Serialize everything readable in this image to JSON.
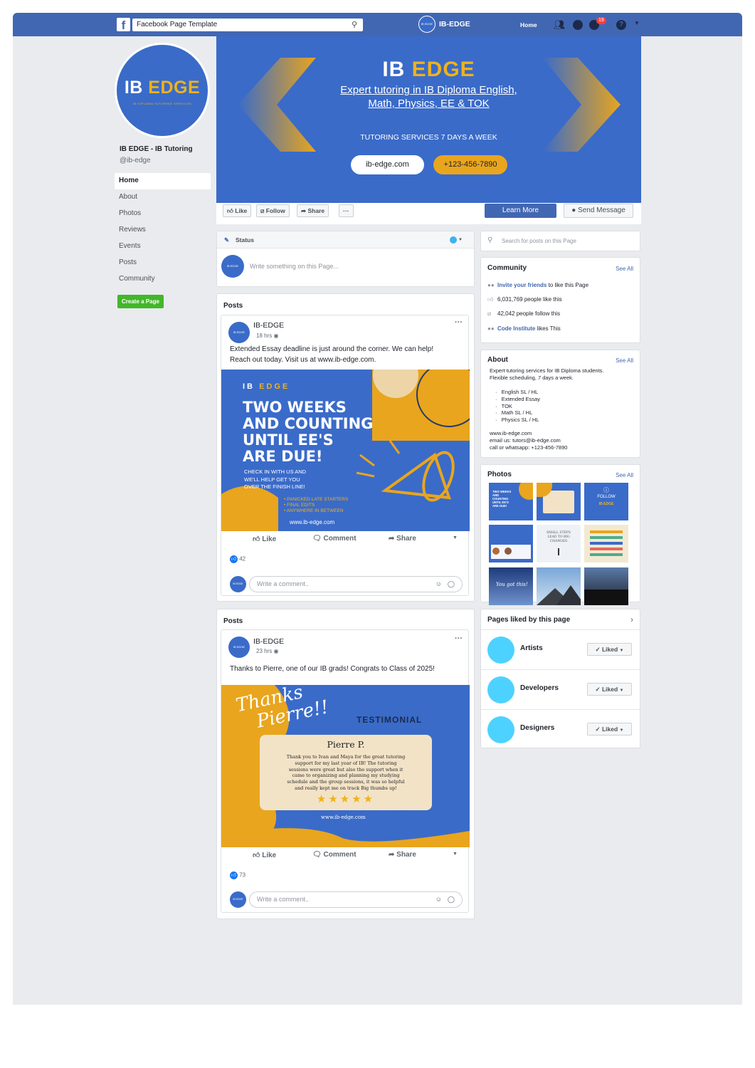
{
  "topbar": {
    "search_value": "Facebook Page Template",
    "brand_badge": "IB EDGE",
    "brand_name": "IB-EDGE",
    "home_label": "Home",
    "notification_count": "19",
    "colors": {
      "bar": "#4267b2"
    }
  },
  "profile": {
    "avatar_word_1": "IB",
    "avatar_word_2": "EDGE",
    "avatar_subtitle": "IB DIPLOMA TUTORING SERVICES",
    "page_name": "IB EDGE - IB Tutoring",
    "handle": "@ib-edge"
  },
  "nav": {
    "items": [
      "Home",
      "About",
      "Photos",
      "Reviews",
      "Events",
      "Posts",
      "Community"
    ],
    "create_page": "Create a Page"
  },
  "cover": {
    "title_1": "IB",
    "title_2": "EDGE",
    "subtitle_line1": "Expert tutoring in IB Diploma English,",
    "subtitle_line2": "Math, Physics, EE & TOK",
    "tagline": "TUTORING SERVICES 7 DAYS A WEEK",
    "website_button": "ib-edge.com",
    "phone_button": "+123-456-7890",
    "colors": {
      "blue": "#3a6bc9",
      "gold": "#e9a51d"
    }
  },
  "actions": {
    "like": "Like",
    "follow": "Follow",
    "share": "Share",
    "more": "···",
    "learn_more": "Learn More",
    "send_message": "Send Message"
  },
  "composer": {
    "status_label": "Status",
    "placeholder": "Write something on this Page..."
  },
  "posts": [
    {
      "section": "Posts",
      "author": "IB-EDGE",
      "time": "18 hrs",
      "text_line1": "Extended Essay deadline is just around the corner. We can help!",
      "text_line2": "Reach out today.  Visit us at www.ib-edge.com.",
      "image": {
        "brand_1": "IB",
        "brand_2": "EDGE",
        "headline": [
          "TWO WEEKS",
          "AND COUNTING",
          "UNTIL EE'S",
          "ARE DUE!"
        ],
        "body": [
          "CHECK IN WITH US AND",
          "WE'LL HELP GET YOU",
          "OVER THE FINISH LINE!"
        ],
        "bullets": [
          "PANICKED LATE STARTERS",
          "FINAL EDITS",
          "ANYWHERE IN BETWEEN"
        ],
        "url": "www.ib-edge.com"
      },
      "like": "Like",
      "comment": "Comment",
      "share": "Share",
      "reactions": "42",
      "comment_placeholder": "Write a comment.."
    },
    {
      "section": "Posts",
      "author": "IB-EDGE",
      "time": "23 hrs",
      "text_line1": "Thanks to Pierre, one of our IB grads!  Congrats to Class of 2025!",
      "image": {
        "script_line1": "Thanks",
        "script_line2": "Pierre!!",
        "label": "TESTIMONIAL",
        "name": "Pierre P.",
        "quote": [
          "Thank you to Ivan and Maya for the great tutoring",
          "support for my last year of IB!  The tutoring",
          "sessions were great but also the support when it",
          "came to organizing and planning my studying",
          "schedule and the group sessions, it was so helpful",
          "and really kept me on track  Big thumbs up!"
        ],
        "rating_stars": 5,
        "url": "www.ib-edge.com"
      },
      "like": "Like",
      "comment": "Comment",
      "share": "Share",
      "reactions": "73",
      "comment_placeholder": "Write a comment.."
    }
  ],
  "right": {
    "search_placeholder": "Search for posts on this Page",
    "community": {
      "title": "Community",
      "see_all": "See All",
      "invite_link": "Invite your friends",
      "invite_rest": " to like this Page",
      "likes": "6,031,769 people like this",
      "follows": "42,042 people follow this",
      "liker_link": "Code Institute",
      "liker_rest": " likes This"
    },
    "about": {
      "title": "About",
      "see_all": "See All",
      "lines": [
        "Expert tutoring services for IB Diploma students.",
        "Flexible scheduling, 7 days a week."
      ],
      "subjects": [
        "English SL / HL",
        "Extended Essay",
        "TOK",
        "Math SL / HL",
        "Physics SL / HL"
      ],
      "contact": [
        "www.ib-edge.com",
        "email us:  tutors@ib-edge.com",
        "call or whatsapp: +123-456-7890"
      ]
    },
    "photos": {
      "title": "Photos",
      "see_all": "See All",
      "thumb_1": "TWO WEEKS AND COUNTING UNTIL EE'S ARE DUE!",
      "thumb_3": "FOLLOW",
      "thumb_5": "SMALL STEPS LEAD TO BIG CHANGES",
      "thumb_7": "You got this!"
    },
    "pages_liked": {
      "title": "Pages liked by this page",
      "pages": [
        "Artists",
        "Developers",
        "Designers"
      ],
      "liked_label": "Liked"
    }
  }
}
